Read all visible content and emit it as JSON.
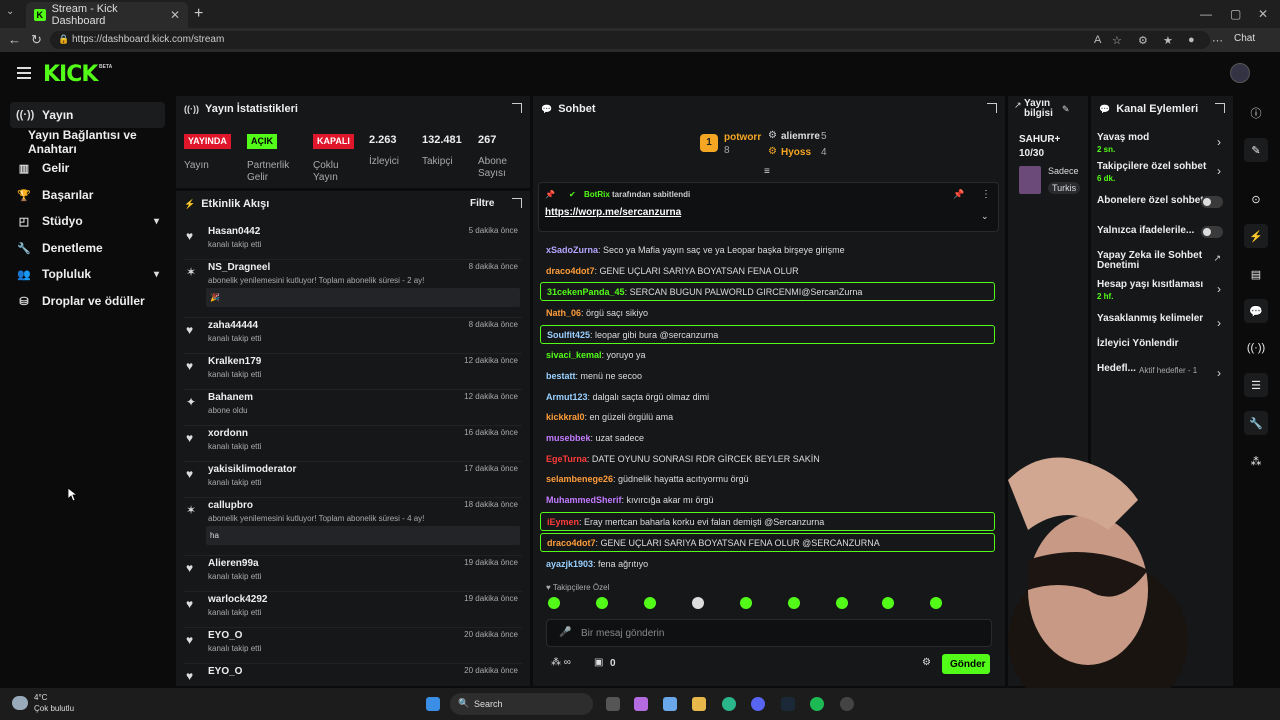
{
  "browser": {
    "tab_title": "Stream - Kick Dashboard",
    "url": "https://dashboard.kick.com/stream",
    "chat_label": "Chat"
  },
  "header": {
    "logo": "KICK",
    "beta": "BETA"
  },
  "sidebar": {
    "items": [
      {
        "label": "Yayın",
        "icon": "broadcast-icon"
      },
      {
        "label": "Yayın Bağlantısı ve Anahtarı"
      },
      {
        "label": "Gelir",
        "icon": "chart-icon"
      },
      {
        "label": "Başarılar",
        "icon": "trophy-icon"
      },
      {
        "label": "Stüdyo",
        "icon": "studio-icon"
      },
      {
        "label": "Denetleme",
        "icon": "wrench-icon"
      },
      {
        "label": "Topluluk",
        "icon": "community-icon"
      },
      {
        "label": "Droplar ve ödüller",
        "icon": "drops-icon"
      }
    ]
  },
  "stats": {
    "title": "Yayın İstatistikleri",
    "badges": [
      "YAYINDA",
      "AÇIK",
      "KAPALI"
    ],
    "labels": [
      "Yayın",
      "Partnerlik\nGelir",
      "Çoklu\nYayın",
      "İzleyici",
      "Takipçi",
      "Abone\nSayısı"
    ],
    "numbers": [
      "2.263",
      "132.481",
      "267"
    ]
  },
  "activity": {
    "title": "Etkinlik Akışı",
    "filter": "Filtre",
    "items": [
      {
        "name": "Hasan0442",
        "sub": "kanalı takip etti",
        "time": "5 dakika önce",
        "icon": "heart"
      },
      {
        "name": "NS_Dragneel",
        "sub": "abonelik yenilemesini kutluyor! Toplam abonelik süresi - 2 ay!",
        "time": "8 dakika önce",
        "icon": "sub",
        "msg": "🎉"
      },
      {
        "name": "zaha44444",
        "sub": "kanalı takip etti",
        "time": "8 dakika önce",
        "icon": "heart"
      },
      {
        "name": "Kralken179",
        "sub": "kanalı takip etti",
        "time": "12 dakika önce",
        "icon": "heart"
      },
      {
        "name": "Bahanem",
        "sub": "abone oldu",
        "time": "12 dakika önce",
        "icon": "star"
      },
      {
        "name": "xordonn",
        "sub": "kanalı takip etti",
        "time": "16 dakika önce",
        "icon": "heart"
      },
      {
        "name": "yakisiklimoderator",
        "sub": "kanalı takip etti",
        "time": "17 dakika önce",
        "icon": "heart"
      },
      {
        "name": "callupbro",
        "sub": "abonelik yenilemesini kutluyor! Toplam abonelik süresi - 4 ay!",
        "time": "18 dakika önce",
        "icon": "sub",
        "msg": "ha"
      },
      {
        "name": "Alieren99a",
        "sub": "kanalı takip etti",
        "time": "19 dakika önce",
        "icon": "heart"
      },
      {
        "name": "warlock4292",
        "sub": "kanalı takip etti",
        "time": "19 dakika önce",
        "icon": "heart"
      },
      {
        "name": "EYO_O",
        "sub": "kanalı takip etti",
        "time": "20 dakika önce",
        "icon": "heart"
      },
      {
        "name": "EYO_O",
        "sub": "",
        "time": "20 dakika önce",
        "icon": "heart"
      }
    ]
  },
  "chat": {
    "title": "Sohbet",
    "leaders": [
      {
        "name": "potworr",
        "count": "8",
        "rank": "1"
      },
      {
        "name": "aliemrre",
        "count": "5"
      },
      {
        "name": "Hyoss",
        "count": "4"
      }
    ],
    "pinned": {
      "by": "BotRix",
      "label": "tarafından sabitlendi",
      "link": "https://worp.me/sercanzurna"
    },
    "messages": [
      {
        "user": "xSadoZurna",
        "color": "#b6a6ff",
        "text": ": Seco ya Mafia yayın saç ve ya Leopar başka birşeye girişme",
        "hl": false
      },
      {
        "user": "draco4dot7",
        "color": "#ff9d3a",
        "text": ": GENE UÇLARI SARIYA BOYATSAN FENA OLUR",
        "hl": false
      },
      {
        "user": "31cekenPanda_45",
        "color": "#53fc18",
        "text": ": SERCAN BUGUN PALWORLD GIRCENMI@SercanZurna",
        "hl": true
      },
      {
        "user": "Nath_06",
        "color": "#ff9d3a",
        "text": ": örgü saçı sikiyo",
        "hl": false
      },
      {
        "user": "Soulfit425",
        "color": "#9ad0ff",
        "text": ": leopar gibi bura @sercanzurna",
        "hl": true
      },
      {
        "user": "sivaci_kemal",
        "color": "#53fc18",
        "text": ": yoruyo ya",
        "hl": false
      },
      {
        "user": "bestatt",
        "color": "#9ad0ff",
        "text": ": menü ne secoo",
        "hl": false
      },
      {
        "user": "Armut123",
        "color": "#9ad0ff",
        "text": ": dalgalı saçta örgü olmaz dimi",
        "hl": false
      },
      {
        "user": "kickkral0",
        "color": "#ff9d3a",
        "text": ": en güzeli örgülü ama",
        "hl": false
      },
      {
        "user": "musebbek",
        "color": "#c27bff",
        "text": ": uzat sadece",
        "hl": false
      },
      {
        "user": "EgeTurna",
        "color": "#ff3b3b",
        "text": ": DATE OYUNU SONRASI RDR GİRCEK BEYLER SAKİN",
        "hl": false
      },
      {
        "user": "selambenege26",
        "color": "#ff9d3a",
        "text": ": güdnelik hayatta acıtıyormu örgü",
        "hl": false
      },
      {
        "user": "MuhammedSherif",
        "color": "#c27bff",
        "text": ": kıvırcığa akar mı örgü",
        "hl": false
      },
      {
        "user": "iEymen",
        "color": "#ff3b3b",
        "text": ": Eray mertcan baharla korku evi falan demişti @Sercanzurna",
        "hl": true
      },
      {
        "user": "draco4dot7",
        "color": "#ff9d3a",
        "text": ": GENE UÇLARI SARIYA BOYATSAN FENA OLUR @SERCANZURNA",
        "hl": true
      },
      {
        "user": "ayazjk1903",
        "color": "#9ad0ff",
        "text": ": fena ağrıtıyo",
        "hl": false
      }
    ],
    "followers_only": "Takipçilere Özel",
    "placeholder": "Bir mesaj gönderin",
    "count": "0",
    "send": "Gönder"
  },
  "info": {
    "title": "Yayın bilgisi",
    "name": "SAHUR+",
    "count": "10/30",
    "tag1": "Sadece",
    "tag2": "Turkis"
  },
  "channel_actions": {
    "title": "Kanal Eylemleri",
    "items": [
      {
        "title": "Yavaş mod",
        "sub": "2 sn.",
        "control": "chevron"
      },
      {
        "title": "Takipçilere özel sohbet",
        "sub": "6 dk.",
        "control": "chevron"
      },
      {
        "title": "Abonelere özel sohbet",
        "sub": "",
        "control": "toggle"
      },
      {
        "title": "Yalnızca ifadelerile...",
        "sub": "",
        "control": "toggle"
      },
      {
        "title": "Yapay Zeka ile Sohbet Denetimi",
        "sub": "",
        "control": "external"
      },
      {
        "title": "Hesap yaşı kısıtlaması",
        "sub": "2 hf.",
        "control": "chevron"
      },
      {
        "title": "Yasaklanmış kelimeler",
        "sub": "",
        "control": "chevron"
      },
      {
        "title": "İzleyici Yönlendir",
        "sub": "",
        "control": "none"
      },
      {
        "title": "Hedefl...",
        "sub": "Aktif hedefler - 1",
        "control": "chevron"
      }
    ]
  },
  "taskbar": {
    "temp": "4°C",
    "weather": "Çok bulutlu",
    "search": "Search"
  },
  "colors": {
    "accent": "#53fc18",
    "live": "#e0162b",
    "panel": "#161719"
  }
}
